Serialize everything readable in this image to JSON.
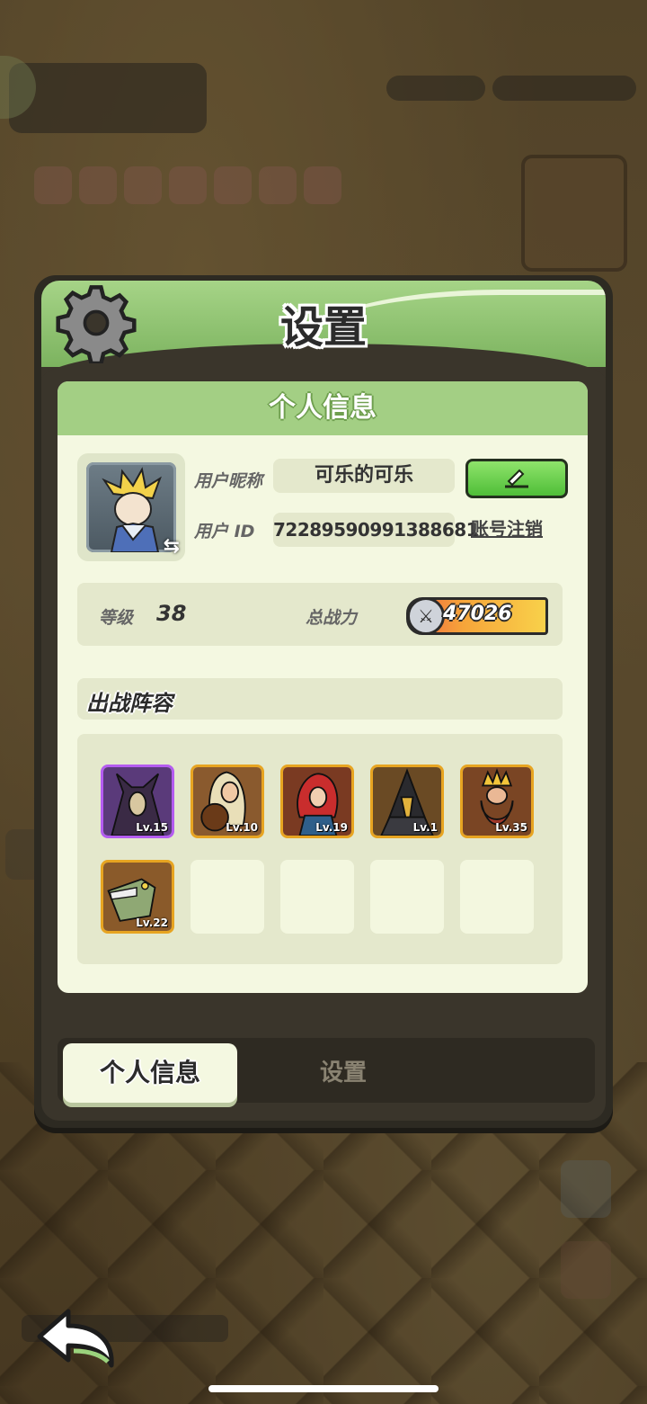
{
  "dialog": {
    "title": "设置",
    "section_title": "个人信息"
  },
  "profile": {
    "nickname_label": "用户昵称",
    "nickname": "可乐的可乐",
    "id_label": "用户 ID",
    "user_id": "72289590991388681",
    "delete_account_label": "账号注销",
    "level_label": "等级",
    "level": "38",
    "power_label": "总战力",
    "power": "47026"
  },
  "team": {
    "title": "出战阵容",
    "heroes": [
      {
        "level": "Lv.15",
        "rarity": "purple",
        "icon": "horned-demon-portrait"
      },
      {
        "level": "Lv.10",
        "rarity": "gold",
        "icon": "bard-lute-portrait"
      },
      {
        "level": "Lv.19",
        "rarity": "gold",
        "icon": "red-hair-warrior-portrait"
      },
      {
        "level": "Lv.1",
        "rarity": "gold",
        "icon": "plague-doctor-portrait"
      },
      {
        "level": "Lv.35",
        "rarity": "gold",
        "icon": "dwarf-king-portrait"
      },
      {
        "level": "Lv.22",
        "rarity": "gold",
        "icon": "crocodile-portrait"
      }
    ],
    "empty_slots": 4
  },
  "tabs": {
    "active": "个人信息",
    "other": "设置"
  },
  "colors": {
    "header_green": "#7cb35f",
    "card_bg": "#f4f8e1",
    "edit_green": "#4fbe38",
    "gold_border": "#e7a421",
    "purple_border": "#b45cf0"
  }
}
